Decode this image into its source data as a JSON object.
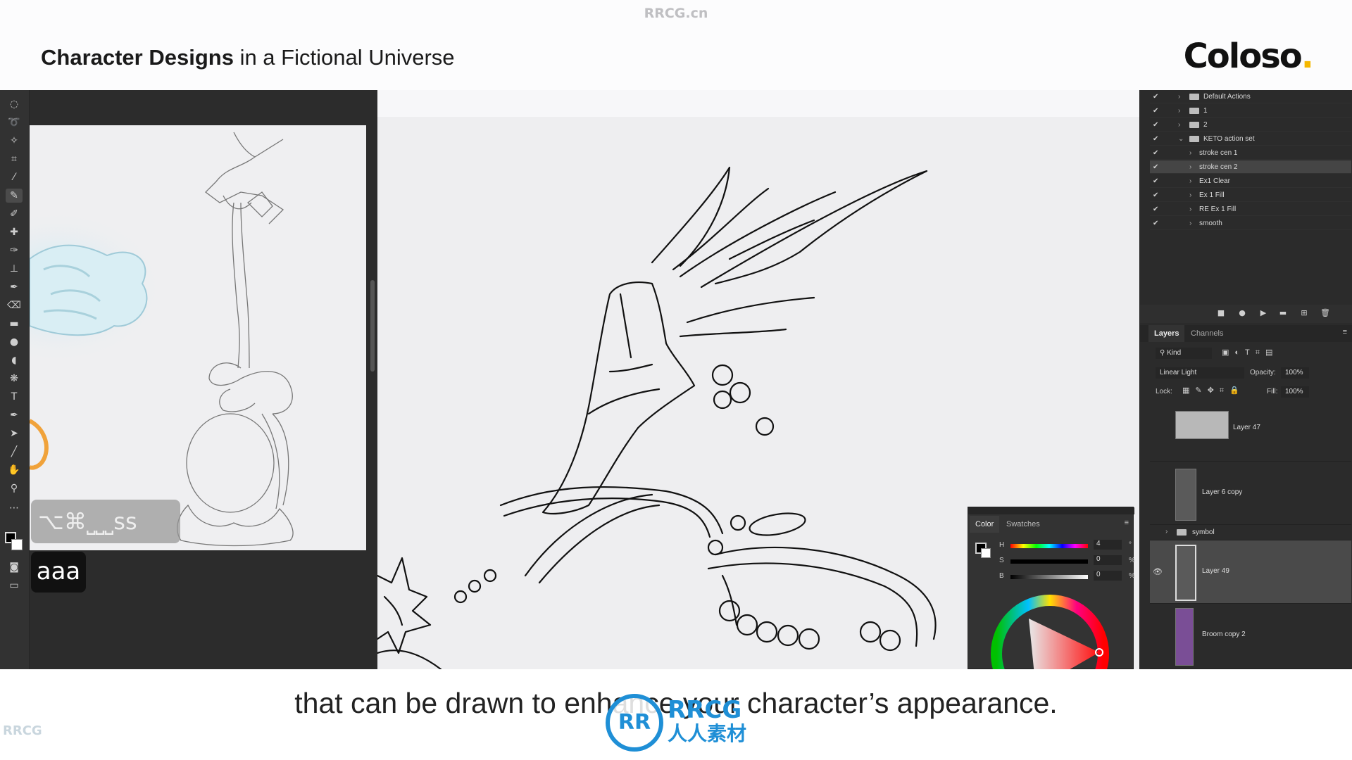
{
  "watermark": "RRCG.cn",
  "header": {
    "title_bold": "Character Designs",
    "title_rest": " in a Fictional Universe",
    "brand": "Coloso",
    "brand_dot": "."
  },
  "left_overlay": {
    "shortcut": "⌥⌘⎵⎵⎵ss",
    "key": "aaa"
  },
  "color_panel": {
    "tabs": [
      "Color",
      "Swatches"
    ],
    "h_label": "H",
    "h_value": "4",
    "h_unit": "°",
    "s_label": "S",
    "s_value": "0",
    "s_unit": "%",
    "b_label": "B",
    "b_value": "0",
    "b_unit": "%"
  },
  "actions": {
    "items": [
      "Default Actions",
      "1",
      "2",
      "KETO action set",
      "stroke cen 1",
      "stroke cen 2",
      "Ex1 Clear",
      "Ex 1 Fill",
      "RE Ex 1 Fill",
      "smooth"
    ]
  },
  "layers_panel": {
    "tabs": [
      "Layers",
      "Channels"
    ],
    "filter": "Kind",
    "blend_mode": "Linear Light",
    "opacity_label": "Opacity:",
    "opacity": "100%",
    "lock_label": "Lock:",
    "fill_label": "Fill:",
    "fill": "100%",
    "layers": [
      "Layer 47",
      "Layer 6 copy",
      "symbol",
      "Layer 49",
      "Broom copy 2"
    ]
  },
  "subtitle": "that can be drawn to enhance your character’s appearance.",
  "subtitle_logo": "RR",
  "subtitle_logo_text": "RRCG",
  "subtitle_logo_cn": "人人素材",
  "corner_logo": "RRCG"
}
